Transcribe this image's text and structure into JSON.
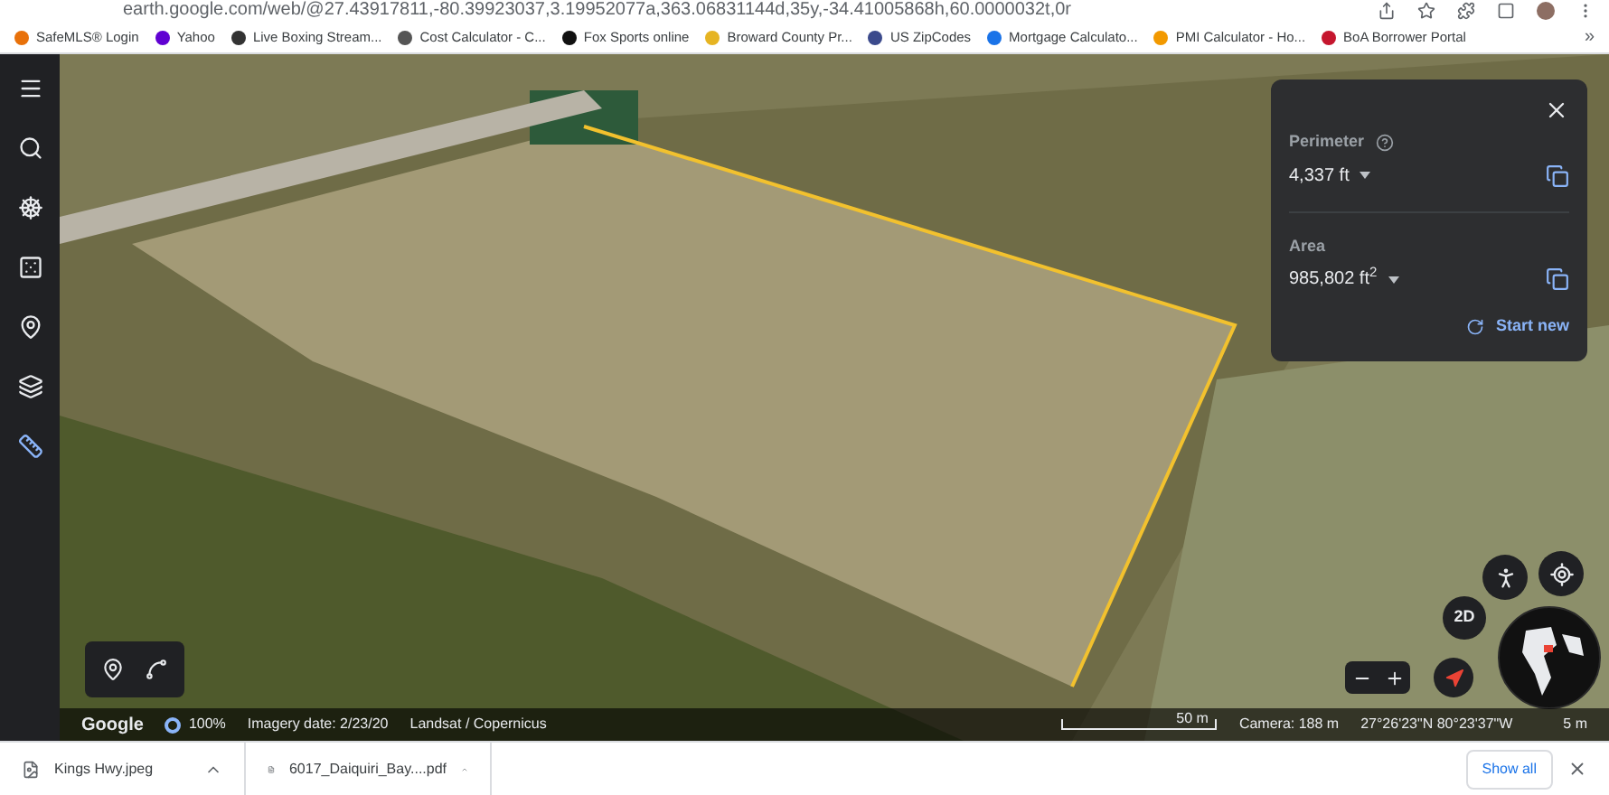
{
  "address_bar": {
    "url": "earth.google.com/web/@27.43917811,-80.39923037,3.19952077a,363.06831144d,35y,-34.41005868h,60.0000032t,0r"
  },
  "bookmarks": [
    {
      "label": "SafeMLS® Login",
      "color": "#e8710a"
    },
    {
      "label": "Yahoo",
      "color": "#6001d2"
    },
    {
      "label": "Live Boxing Stream...",
      "color": "#333333"
    },
    {
      "label": "Cost Calculator - C...",
      "color": "#555555"
    },
    {
      "label": "Fox Sports online",
      "color": "#111111"
    },
    {
      "label": "Broward County Pr...",
      "color": "#e6b422"
    },
    {
      "label": "US ZipCodes",
      "color": "#3b4a8c"
    },
    {
      "label": "Mortgage Calculato...",
      "color": "#1a73e8"
    },
    {
      "label": "PMI Calculator - Ho...",
      "color": "#f29900"
    },
    {
      "label": "BoA Borrower Portal",
      "color": "#c5162e"
    }
  ],
  "bookmarks_overflow": "»",
  "sidebar": {
    "items": [
      {
        "kind": "menu",
        "selected": false
      },
      {
        "kind": "search",
        "selected": false
      },
      {
        "kind": "voyager",
        "selected": false
      },
      {
        "kind": "feeling-lucky",
        "selected": false
      },
      {
        "kind": "projects",
        "selected": false
      },
      {
        "kind": "layers",
        "selected": false
      },
      {
        "kind": "measure",
        "selected": true
      }
    ]
  },
  "measure_panel": {
    "perimeter": {
      "label": "Perimeter",
      "value": "4,337 ft"
    },
    "area": {
      "label": "Area",
      "value": "985,802 ft$^{2}$"
    },
    "start_new": "Start new"
  },
  "map_controls": {
    "view_toggle": "2D"
  },
  "status_bar": {
    "attribution": "Google",
    "zoom": "100%",
    "imagery_date": "Imagery date: 2/23/20",
    "source": "Landsat / Copernicus",
    "scale": "50 m",
    "camera": "Camera: 188 m",
    "coordinates": "27°26'23\"N 80°23'37\"W",
    "elevation": "5 m"
  },
  "downloads": {
    "files": [
      {
        "name": "Kings Hwy.jpeg",
        "kind": "image"
      },
      {
        "name": "6017_Daiquiri_Bay....pdf",
        "kind": "pdf"
      }
    ],
    "show_all": "Show all"
  }
}
